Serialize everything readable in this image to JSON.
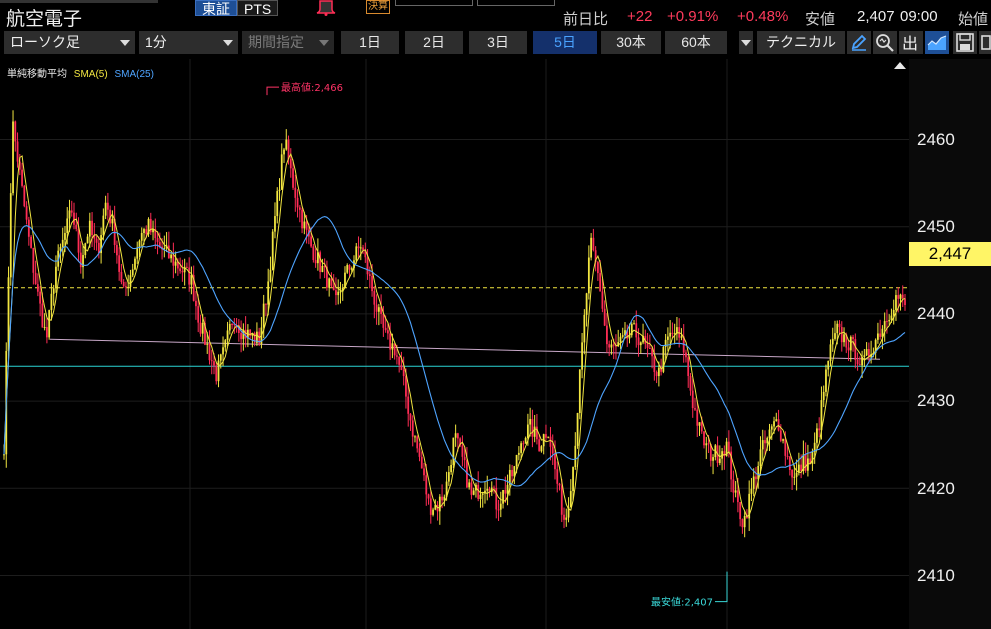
{
  "header": {
    "stock_name": "航空電子",
    "market_tabs": [
      {
        "label": "東証",
        "active": true
      },
      {
        "label": "PTS",
        "active": false
      }
    ],
    "badge_kessan": "決算",
    "prev_day_label": "前日比",
    "change": "+22",
    "change_pct": "+0.91%",
    "change_pct2": "+0.48%",
    "low_label": "安値",
    "low_value": "2,407",
    "low_time": "09:00",
    "open_label": "始値"
  },
  "toolbar": {
    "chart_type": "ローソク足",
    "interval": "1分",
    "period_select": "期間指定",
    "periods": [
      {
        "label": "1日",
        "active": false
      },
      {
        "label": "2日",
        "active": false
      },
      {
        "label": "3日",
        "active": false
      },
      {
        "label": "5日",
        "active": true
      },
      {
        "label": "30本",
        "active": false
      },
      {
        "label": "60本",
        "active": false
      }
    ],
    "technical_label": "テクニカル",
    "icons": [
      "pencil-icon",
      "zoom-icon",
      "volume-icon",
      "area-chart-icon",
      "save-icon",
      "print-icon"
    ]
  },
  "colors": {
    "sma5": "#f2e641",
    "sma25": "#4ea4ff",
    "up_candle": "#f2e641",
    "down_candle": "#ff2d55",
    "high_marker": "#ff3366",
    "low_marker": "#3ad8d8",
    "prev_close_line": "#2ad4d4",
    "price_dashed_line": "#f2e641",
    "trend_line": "#c8a8c8",
    "last_price_bg": "#fff566"
  },
  "chart_data": {
    "type": "candlestick",
    "legend": {
      "title": "単純移動平均",
      "sma5": "SMA(5)",
      "sma25": "SMA(25)"
    },
    "y_ticks": [
      "2460",
      "2450",
      "2440",
      "2430",
      "2420",
      "2410"
    ],
    "last_price": "2,447",
    "high_annotation": "最高値:2,466",
    "low_annotation": "最安値:2,407",
    "prev_close": 2434,
    "price_line": 2443,
    "ylim": [
      2404,
      2470
    ],
    "price_path": [
      [
        0,
        2425
      ],
      [
        1,
        2462
      ],
      [
        2,
        2455
      ],
      [
        3,
        2448
      ],
      [
        4,
        2442
      ],
      [
        5,
        2437
      ],
      [
        6,
        2445
      ],
      [
        8,
        2452
      ],
      [
        9,
        2446
      ],
      [
        10,
        2450
      ],
      [
        11,
        2447
      ],
      [
        12,
        2453
      ],
      [
        13,
        2449
      ],
      [
        14,
        2442
      ],
      [
        15,
        2445
      ],
      [
        16,
        2449
      ],
      [
        17,
        2450
      ],
      [
        18,
        2448
      ],
      [
        20,
        2446
      ],
      [
        22,
        2444
      ],
      [
        23,
        2439
      ],
      [
        24,
        2436
      ],
      [
        25,
        2433
      ],
      [
        26,
        2436
      ],
      [
        27,
        2440
      ],
      [
        28,
        2438
      ],
      [
        30,
        2437
      ],
      [
        31,
        2443
      ],
      [
        32,
        2452
      ],
      [
        33,
        2460
      ],
      [
        34,
        2455
      ],
      [
        35,
        2451
      ],
      [
        36,
        2448
      ],
      [
        37,
        2446
      ],
      [
        38,
        2444
      ],
      [
        39,
        2441
      ],
      [
        40,
        2444
      ],
      [
        41,
        2446
      ],
      [
        42,
        2448
      ],
      [
        43,
        2444
      ],
      [
        44,
        2440
      ],
      [
        45,
        2437
      ],
      [
        46,
        2436
      ],
      [
        47,
        2432
      ],
      [
        48,
        2427
      ],
      [
        49,
        2423
      ],
      [
        50,
        2418
      ],
      [
        51,
        2418
      ],
      [
        52,
        2420
      ],
      [
        53,
        2426
      ],
      [
        54,
        2423
      ],
      [
        55,
        2419
      ],
      [
        56,
        2420
      ],
      [
        57,
        2421
      ],
      [
        58,
        2418
      ],
      [
        60,
        2422
      ],
      [
        61,
        2426
      ],
      [
        62,
        2427
      ],
      [
        63,
        2425
      ],
      [
        64,
        2427
      ],
      [
        65,
        2421
      ],
      [
        66,
        2416
      ],
      [
        67,
        2423
      ],
      [
        68,
        2436
      ],
      [
        69,
        2448
      ],
      [
        70,
        2444
      ],
      [
        71,
        2436
      ],
      [
        72,
        2436
      ],
      [
        73,
        2437
      ],
      [
        74,
        2438
      ],
      [
        75,
        2437
      ],
      [
        76,
        2435
      ],
      [
        77,
        2433
      ],
      [
        78,
        2437
      ],
      [
        79,
        2438
      ],
      [
        80,
        2436
      ],
      [
        81,
        2430
      ],
      [
        82,
        2426
      ],
      [
        83,
        2424
      ],
      [
        84,
        2424
      ],
      [
        85,
        2425
      ],
      [
        86,
        2419
      ],
      [
        87,
        2416
      ],
      [
        88,
        2420
      ],
      [
        89,
        2424
      ],
      [
        90,
        2426
      ],
      [
        91,
        2428
      ],
      [
        92,
        2424
      ],
      [
        93,
        2421
      ],
      [
        94,
        2423
      ],
      [
        95,
        2423
      ],
      [
        96,
        2428
      ],
      [
        97,
        2435
      ],
      [
        98,
        2438
      ],
      [
        99,
        2437
      ],
      [
        100,
        2436
      ],
      [
        101,
        2434
      ],
      [
        102,
        2436
      ],
      [
        103,
        2438
      ],
      [
        104,
        2440
      ],
      [
        105,
        2442
      ],
      [
        106,
        2441
      ]
    ]
  }
}
